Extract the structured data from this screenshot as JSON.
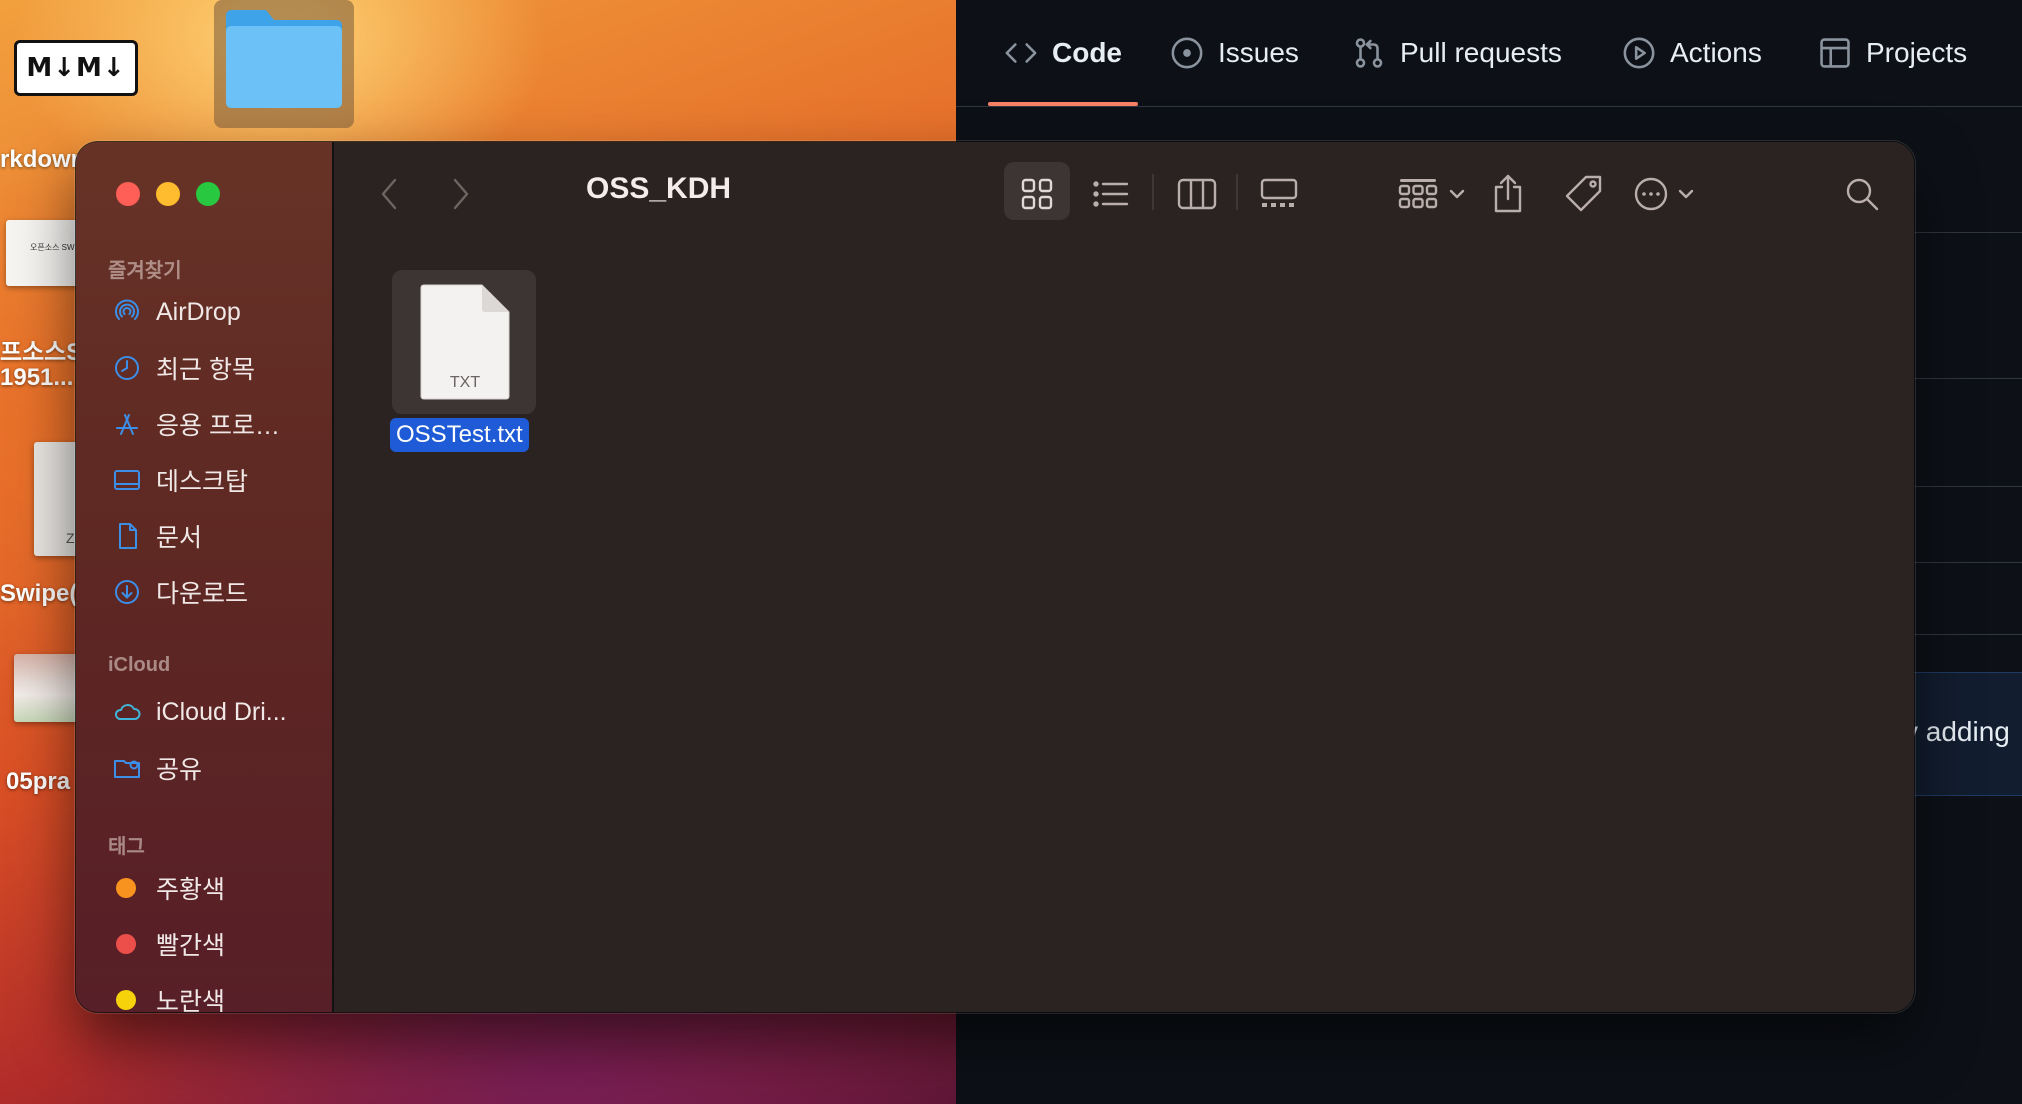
{
  "desktop": {
    "md_badge": "M↓M↓",
    "labels": {
      "markdown": "rkdown",
      "opensource_1": "프소스S",
      "opensource_2": "1951...",
      "swipe": "Swipe(",
      "practice": "05pra"
    },
    "thumb_text": "오픈소스 SW",
    "zip_letter": "Z"
  },
  "github": {
    "tabs": [
      {
        "label": "Code",
        "icon": "code-icon"
      },
      {
        "label": "Issues",
        "icon": "issue-icon"
      },
      {
        "label": "Pull requests",
        "icon": "pull-request-icon"
      },
      {
        "label": "Actions",
        "icon": "play-icon"
      },
      {
        "label": "Projects",
        "icon": "table-icon"
      }
    ],
    "banner_fragment": "y adding",
    "colors": {
      "background": "#0d1117",
      "tab_underline": "#f78166"
    }
  },
  "finder": {
    "title": "OSS_KDH",
    "sidebar": {
      "favorites_header": "즐겨찾기",
      "favorites": [
        {
          "label": "AirDrop",
          "icon": "airdrop-icon"
        },
        {
          "label": "최근 항목",
          "icon": "clock-icon"
        },
        {
          "label": "응용 프로…",
          "icon": "applications-icon"
        },
        {
          "label": "데스크탑",
          "icon": "desktop-icon"
        },
        {
          "label": "문서",
          "icon": "document-icon"
        },
        {
          "label": "다운로드",
          "icon": "download-icon"
        }
      ],
      "icloud_header": "iCloud",
      "icloud": [
        {
          "label": "iCloud Dri...",
          "icon": "cloud-icon"
        },
        {
          "label": "공유",
          "icon": "shared-folder-icon"
        }
      ],
      "tags_header": "태그",
      "tags": [
        {
          "label": "주황색",
          "color": "#f7931e"
        },
        {
          "label": "빨간색",
          "color": "#ec4f4a"
        },
        {
          "label": "노란색",
          "color": "#f5d20a"
        }
      ]
    },
    "files": [
      {
        "name": "OSSTest.txt",
        "type_label": "TXT",
        "selected": true
      }
    ],
    "colors": {
      "selection": "#1f5bd6",
      "close": "#ff5f57",
      "minimize": "#febc2e",
      "zoom": "#28c840"
    }
  }
}
